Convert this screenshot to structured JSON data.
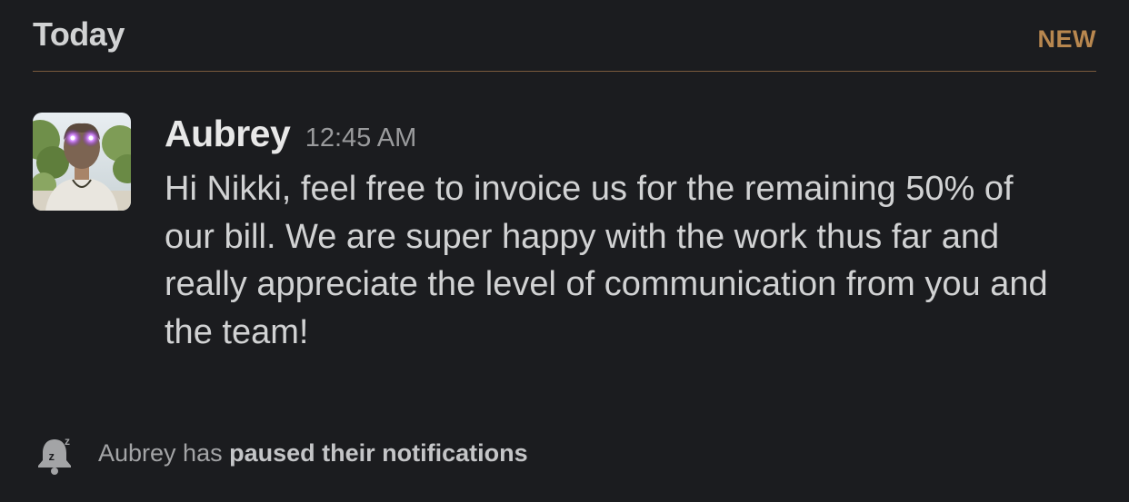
{
  "divider": {
    "title": "Today",
    "new_label": "NEW",
    "accent_color": "#b8874f"
  },
  "message": {
    "author": "Aubrey",
    "time": "12:45 AM",
    "text": "Hi Nikki, feel free to invoice us for the remaining 50% of our bill. We are super happy with the work thus far and really appreciate the level of communication from you and the team!",
    "avatar_icon": "user-photo-avatar"
  },
  "notice": {
    "icon": "bell-snooze-icon",
    "prefix": "Aubrey has ",
    "emphasis": "paused their notifications"
  }
}
